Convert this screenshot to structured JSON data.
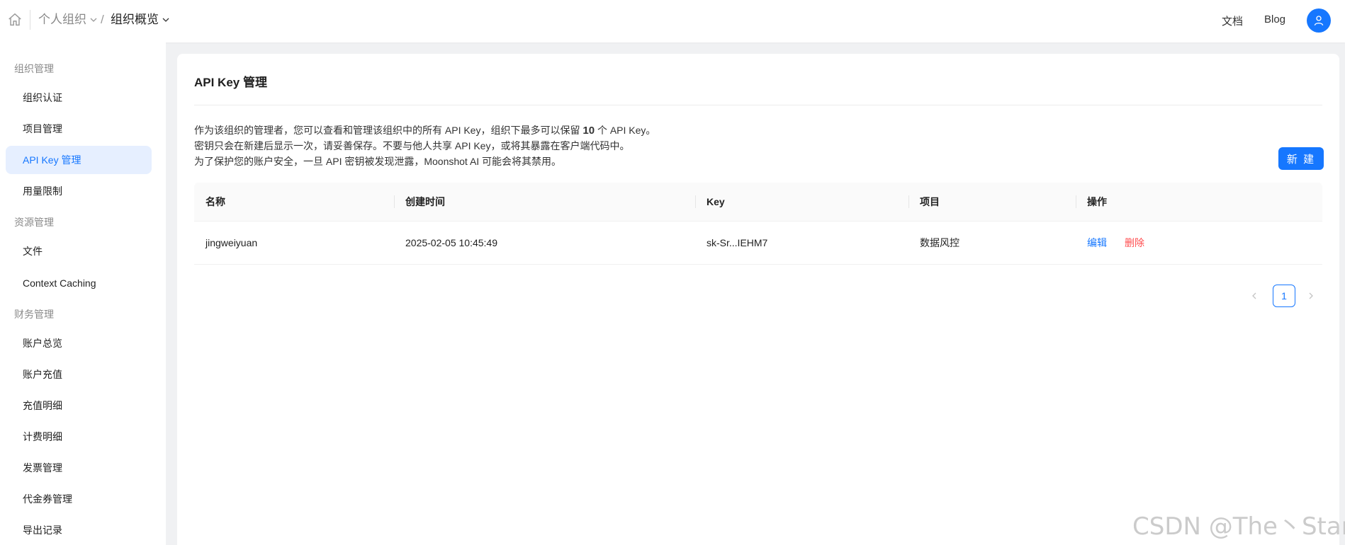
{
  "breadcrumb": {
    "org": "个人组织",
    "separator": "/",
    "page": "组织概览"
  },
  "top_links": {
    "docs": "文档",
    "blog": "Blog"
  },
  "sidebar": {
    "groups": [
      {
        "title": "组织管理",
        "items": [
          "组织认证",
          "项目管理",
          "API Key 管理",
          "用量限制"
        ]
      },
      {
        "title": "资源管理",
        "items": [
          "文件",
          "Context Caching"
        ]
      },
      {
        "title": "财务管理",
        "items": [
          "账户总览",
          "账户充值",
          "充值明细",
          "计费明细",
          "发票管理",
          "代金券管理",
          "导出记录"
        ]
      }
    ],
    "active_item": "API Key 管理"
  },
  "main": {
    "title": "API Key 管理",
    "desc_line1_a": "作为该组织的管理者，您可以查看和管理该组织中的所有 API Key，组织下最多可以保留",
    "desc_line1_count": "10",
    "desc_line1_b": "个 API Key。",
    "desc_line2": "密钥只会在新建后显示一次，请妥善保存。不要与他人共享 API Key，或将其暴露在客户端代码中。",
    "desc_line3": "为了保护您的账户安全，一旦 API 密钥被发现泄露，Moonshot AI 可能会将其禁用。",
    "new_button": "新 建"
  },
  "table": {
    "columns": [
      "名称",
      "创建时间",
      "Key",
      "项目",
      "操作"
    ],
    "rows": [
      {
        "name": "jingweiyuan",
        "created": "2025-02-05 10:45:49",
        "key": "sk-Sr...IEHM7",
        "project": "数据风控",
        "edit": "编辑",
        "delete": "删除"
      }
    ]
  },
  "pagination": {
    "current_page": "1"
  },
  "watermark": "CSDN @The丶Star",
  "colors": {
    "accent": "#1677ff",
    "danger": "#ff4d4f",
    "active_bg": "#e6efff"
  }
}
